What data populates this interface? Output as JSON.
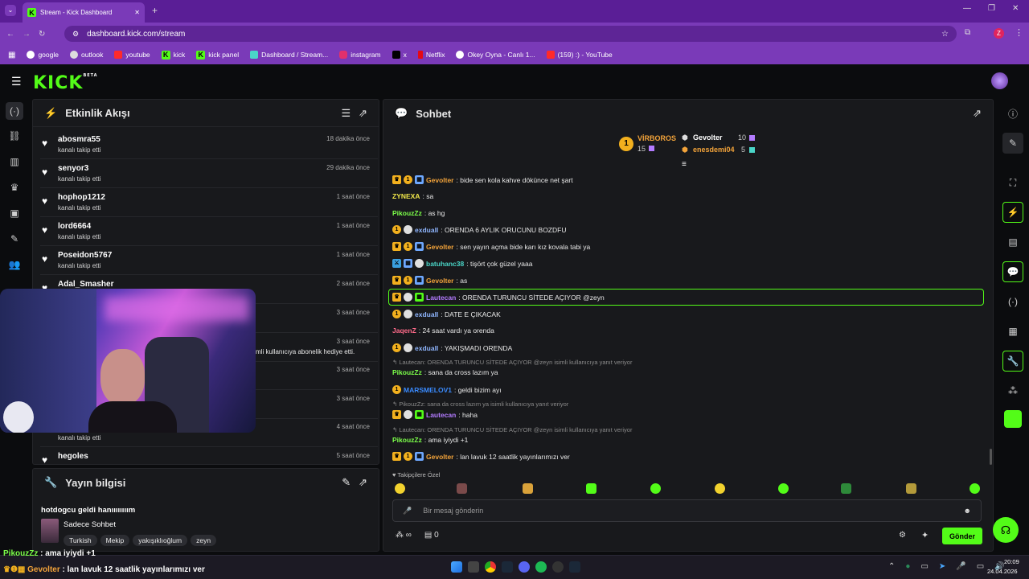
{
  "browser": {
    "tab_title": "Stream - Kick Dashboard",
    "url": "dashboard.kick.com/stream",
    "bookmarks": [
      "google",
      "outlook",
      "youtube",
      "kick",
      "kick panel",
      "Dashboard / Stream...",
      "instagram",
      "x",
      "Netflix",
      "Okey Oyna - Canlı 1...",
      "(159) :) - YouTube"
    ],
    "profile_initial": "Z"
  },
  "kick": {
    "logo": "KICK",
    "beta": "BETA"
  },
  "activity": {
    "title": "Etkinlik Akışı",
    "items": [
      {
        "name": "abosmra55",
        "action": "kanalı takip etti",
        "time": "18 dakika önce"
      },
      {
        "name": "senyor3",
        "action": "kanalı takip etti",
        "time": "29 dakika önce"
      },
      {
        "name": "hophop1212",
        "action": "kanalı takip etti",
        "time": "1 saat önce"
      },
      {
        "name": "lord6664",
        "action": "kanalı takip etti",
        "time": "1 saat önce"
      },
      {
        "name": "Poseidon5767",
        "action": "kanalı takip etti",
        "time": "1 saat önce"
      },
      {
        "name": "Adal_Smasher",
        "action": "",
        "time": "2 saat önce"
      },
      {
        "name": "",
        "action": "",
        "time": "3 saat önce"
      },
      {
        "name": "",
        "action": "mli kullanıcıya abonelik hediye etti.",
        "time": "3 saat önce"
      },
      {
        "name": "",
        "action": "",
        "time": "3 saat önce"
      },
      {
        "name": "",
        "action": "",
        "time": "3 saat önce"
      },
      {
        "name": "",
        "action": "kanalı takip etti",
        "time": "4 saat önce"
      },
      {
        "name": "hegoles",
        "action": "",
        "time": "5 saat önce"
      }
    ]
  },
  "stream_info": {
    "title": "Yayın bilgisi",
    "stream_title": "hotdogcu geldi hanıııııııım",
    "category": "Sadece Sohbet",
    "tags": [
      "Turkish",
      "Mekip",
      "yakışıklıoğlum",
      "zeyn"
    ]
  },
  "chat": {
    "title": "Sohbet",
    "leaderboard": {
      "first": {
        "rank": "1",
        "name": "VİRBOROS",
        "count": "15"
      },
      "second": {
        "name": "Gevolter",
        "count": "10"
      },
      "third": {
        "name": "enesdemi04",
        "count": "5"
      }
    },
    "messages": [
      {
        "user": "Gevolter",
        "text": ": bide sen kola kahve dökünce net şart",
        "color": "#f2a33a"
      },
      {
        "user": "ZYNEXA",
        "text": ": sa",
        "color": "#f2e94a"
      },
      {
        "user": "PikouzZz",
        "text": ": as hg",
        "color": "#7cff4a"
      },
      {
        "user": "exduall",
        "text": ": ORENDA 6 AYLIK ORUCUNU BOZDFU",
        "color": "#8fb6ff"
      },
      {
        "user": "Gevolter",
        "text": ": sen yayın açma bide karı kız kovala tabi ya",
        "color": "#f2a33a"
      },
      {
        "user": "batuhanc38",
        "text": ": tişört çok güzel yaaa",
        "color": "#4ad6c8"
      },
      {
        "user": "Gevolter",
        "text": ": as",
        "color": "#f2a33a"
      },
      {
        "user": "Lautecan",
        "text": ": ORENDA TURUNCU SİTEDE AÇIYOR @zeyn",
        "color": "#b37bff"
      },
      {
        "user": "exduall",
        "text": ": DATE E ÇIKACAK",
        "color": "#8fb6ff"
      },
      {
        "user": "JaqenZ",
        "text": ": 24 saat vardı ya orenda",
        "color": "#ff6b8a"
      },
      {
        "user": "exduall",
        "text": ": YAKIŞMADI ORENDA",
        "color": "#8fb6ff"
      },
      {
        "user": "PikouzZz",
        "text": ": sana da cross lazım ya",
        "color": "#7cff4a"
      },
      {
        "user": "MARSMELOV1",
        "text": ": geldi bizim ayı",
        "color": "#3a8bff"
      },
      {
        "user": "Lautecan",
        "text": ": haha",
        "color": "#b37bff"
      },
      {
        "user": "PikouzZz",
        "text": ": ama iyiydi +1",
        "color": "#7cff4a"
      },
      {
        "user": "Gevolter",
        "text": ": lan lavuk 12 saatlik yayınlarımızı ver",
        "color": "#f2a33a"
      }
    ],
    "replies": [
      "Lautecan: ORENDA TURUNCU SİTEDE AÇIYOR @zeyn isimli kullanıcıya yanıt veriyor",
      "PikouzZz: sana da cross lazım ya isimli kullanıcıya yanıt veriyor",
      "Lautecan: ORENDA TURUNCU SİTEDE AÇIYOR @zeyn isimli kullanıcıya yanıt veriyor"
    ],
    "followers_only": "Takipçilere Özel",
    "input_placeholder": "Bir mesaj gönderin",
    "send_label": "Gönder",
    "infinity": "∞",
    "store_count": "0"
  },
  "overlay": {
    "line1_user": "PikouzZz",
    "line1_text": " : ama iyiydi +1",
    "line2_user": "Gevolter",
    "line2_text": " : lan lavuk 12 saatlik yayınlarımızı ver"
  },
  "taskbar": {
    "time": "20:09",
    "date": "24.04.2026"
  }
}
